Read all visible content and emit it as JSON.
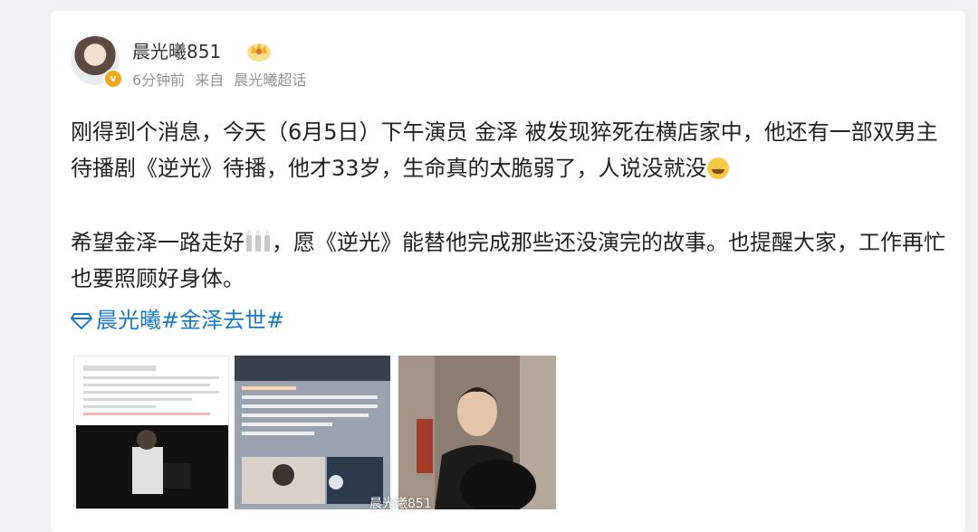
{
  "post": {
    "username": "晨光曦851",
    "time": "6分钟前",
    "source_prefix": "来自",
    "source": "晨光曦超话",
    "paragraph1": "刚得到个消息，今天（6月5日）下午演员 金泽 被发现猝死在横店家中，他还有一部双男主待播剧《逆光》待播，他才33岁，生命真的太脆弱了，人说没就没",
    "paragraph2_before": "希望金泽一路走好",
    "paragraph2_after": "，愿《逆光》能替他完成那些还没演完的故事。也提醒大家，工作再忙也要照顾好身体。",
    "topic": "晨光曦#金泽去世#"
  },
  "images": {
    "watermark": "晨光曦851"
  },
  "icons": {
    "avatar": "avatar",
    "verified": "verified-badge-icon",
    "crown": "crown-icon",
    "crying": "crying-emoji-icon",
    "candle": "candle-emoji-icon",
    "topic": "diamond-topic-icon"
  },
  "colors": {
    "topic": "#1b78c7",
    "verified": "#f0a91b",
    "meta_text": "#939393"
  }
}
